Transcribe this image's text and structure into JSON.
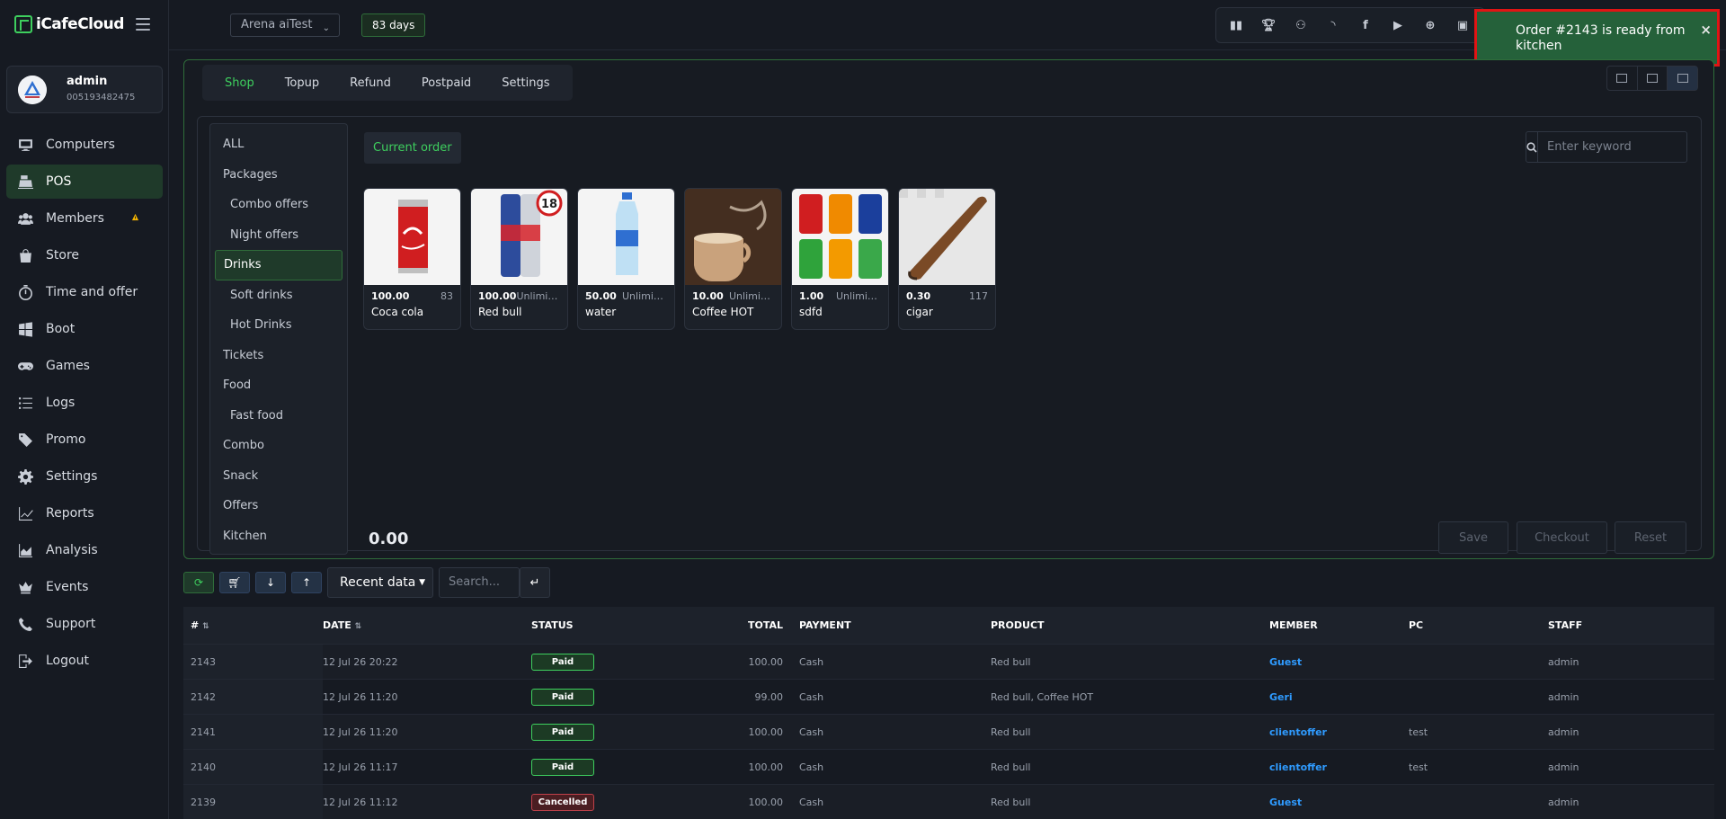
{
  "app": {
    "name": "iCafeCloud"
  },
  "user": {
    "name": "admin",
    "id": "005193482475"
  },
  "nav": [
    {
      "label": "Computers",
      "icon": "monitor-icon"
    },
    {
      "label": "POS",
      "icon": "cash-register-icon",
      "active": true
    },
    {
      "label": "Members",
      "icon": "users-icon",
      "warning": true
    },
    {
      "label": "Store",
      "icon": "bag-icon"
    },
    {
      "label": "Time and offer",
      "icon": "stopwatch-icon"
    },
    {
      "label": "Boot",
      "icon": "windows-icon"
    },
    {
      "label": "Games",
      "icon": "gamepad-icon"
    },
    {
      "label": "Logs",
      "icon": "list-icon"
    },
    {
      "label": "Promo",
      "icon": "tag-icon"
    },
    {
      "label": "Settings",
      "icon": "gear-icon"
    },
    {
      "label": "Reports",
      "icon": "line-chart-icon"
    },
    {
      "label": "Analysis",
      "icon": "area-chart-icon"
    },
    {
      "label": "Events",
      "icon": "crown-icon"
    },
    {
      "label": "Support",
      "icon": "phone-icon"
    },
    {
      "label": "Logout",
      "icon": "logout-icon"
    }
  ],
  "topbar": {
    "branch": "Arena aiTest",
    "days": "83 days",
    "icons": [
      "leaderboard-icon",
      "trophy-icon",
      "group-icon",
      "rss-icon",
      "facebook-icon",
      "youtube-icon",
      "globe-icon",
      "icafe-icon"
    ]
  },
  "toast": {
    "message": "Order #2143 is ready from kitchen",
    "close": "×"
  },
  "tabs": [
    "Shop",
    "Topup",
    "Refund",
    "Postpaid",
    "Settings"
  ],
  "categories": [
    {
      "label": "ALL",
      "sub": false
    },
    {
      "label": "Packages",
      "sub": false
    },
    {
      "label": "Combo offers",
      "sub": true
    },
    {
      "label": "Night offers",
      "sub": true
    },
    {
      "label": "Drinks",
      "sub": false,
      "active": true
    },
    {
      "label": "Soft drinks",
      "sub": true
    },
    {
      "label": "Hot Drinks",
      "sub": true
    },
    {
      "label": "Tickets",
      "sub": false
    },
    {
      "label": "Food",
      "sub": false
    },
    {
      "label": "Fast food",
      "sub": true
    },
    {
      "label": "Combo",
      "sub": false
    },
    {
      "label": "Snack",
      "sub": false
    },
    {
      "label": "Offers",
      "sub": false
    },
    {
      "label": "Kitchen",
      "sub": false
    }
  ],
  "current_order": "Current order",
  "search": {
    "placeholder": "Enter keyword"
  },
  "products": [
    {
      "name": "Coca cola",
      "price": "100.00",
      "stock": "83"
    },
    {
      "name": "Red bull",
      "price": "100.00",
      "stock": "Unlimited"
    },
    {
      "name": "water",
      "price": "50.00",
      "stock": "Unlimited"
    },
    {
      "name": "Coffee HOT",
      "price": "10.00",
      "stock": "Unlimited"
    },
    {
      "name": "sdfd",
      "price": "1.00",
      "stock": "Unlimited"
    },
    {
      "name": "cigar",
      "price": "0.30",
      "stock": "117"
    }
  ],
  "total": "0.00",
  "actions": {
    "save": "Save",
    "checkout": "Checkout",
    "reset": "Reset"
  },
  "toolbar": {
    "filter": "Recent data",
    "search_placeholder": "Search...",
    "enter": "↵"
  },
  "table": {
    "headers": [
      "#",
      "DATE",
      "STATUS",
      "TOTAL",
      "PAYMENT",
      "PRODUCT",
      "MEMBER",
      "PC",
      "STAFF"
    ],
    "rows": [
      {
        "id": "2143",
        "date": "12 Jul 26 20:22",
        "status": "Paid",
        "total": "100.00",
        "payment": "Cash",
        "product": "Red bull",
        "member": "Guest",
        "pc": "",
        "staff": "admin"
      },
      {
        "id": "2142",
        "date": "12 Jul 26 11:20",
        "status": "Paid",
        "total": "99.00",
        "payment": "Cash",
        "product": "Red bull, Coffee HOT",
        "member": "Geri",
        "pc": "",
        "staff": "admin"
      },
      {
        "id": "2141",
        "date": "12 Jul 26 11:20",
        "status": "Paid",
        "total": "100.00",
        "payment": "Cash",
        "product": "Red bull",
        "member": "clientoffer",
        "pc": "test",
        "staff": "admin"
      },
      {
        "id": "2140",
        "date": "12 Jul 26 11:17",
        "status": "Paid",
        "total": "100.00",
        "payment": "Cash",
        "product": "Red bull",
        "member": "clientoffer",
        "pc": "test",
        "staff": "admin"
      },
      {
        "id": "2139",
        "date": "12 Jul 26 11:12",
        "status": "Cancelled",
        "total": "100.00",
        "payment": "Cash",
        "product": "Red bull",
        "member": "Guest",
        "pc": "",
        "staff": "admin"
      }
    ]
  },
  "colors": {
    "accent": "#3ecf5e",
    "link": "#2f9bff",
    "toast_bg": "#25613a",
    "highlight_border": "#e01414",
    "cancelled": "#c0414a"
  }
}
